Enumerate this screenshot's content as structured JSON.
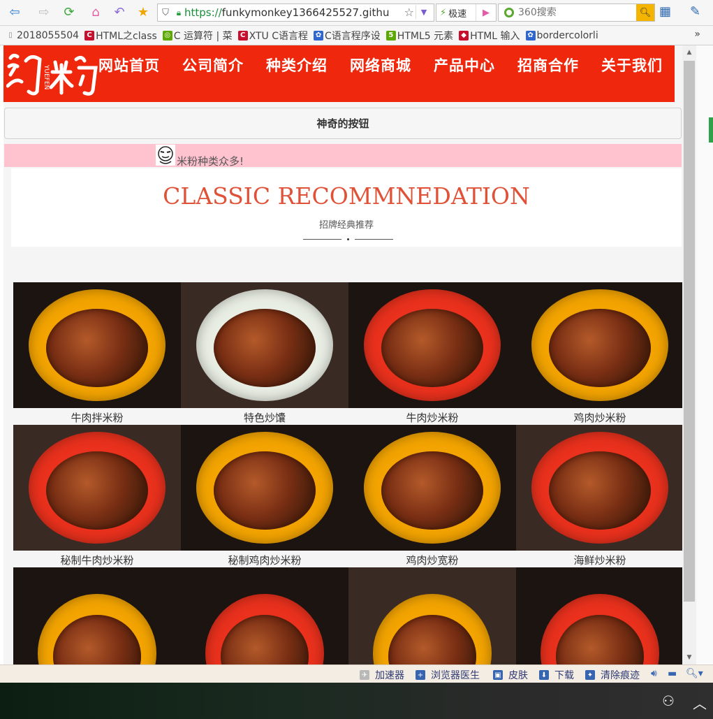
{
  "browser": {
    "url_protocol": "https://",
    "url_rest": "funkymonkey1366425527.githu",
    "speed_label": "极速",
    "search_placeholder": "360搜索",
    "bookmarks": [
      {
        "label": "2018055504",
        "icon": "page-icon",
        "color": "#888888"
      },
      {
        "label": "HTML之class",
        "icon": "c-icon",
        "color": "#c8102e"
      },
      {
        "label": "C 运算符 | 菜",
        "icon": "runoob-icon",
        "color": "#5aa800"
      },
      {
        "label": "XTU C语言程",
        "icon": "c-icon",
        "color": "#c8102e"
      },
      {
        "label": "C语言程序设",
        "icon": "paw-icon",
        "color": "#2f66d0"
      },
      {
        "label": "HTML5 元素",
        "icon": "html5-icon",
        "color": "#5aa800"
      },
      {
        "label": "HTML 输入",
        "icon": "w3-icon",
        "color": "#c8102e"
      },
      {
        "label": "bordercolorli",
        "icon": "paw-icon",
        "color": "#2f66d0"
      }
    ],
    "bookmarks_more": "»"
  },
  "site": {
    "logo_text": "约粉",
    "logo_sub": "YUEFEN",
    "nav": [
      "网站首页",
      "公司简介",
      "种类介绍",
      "网络商城",
      "产品中心",
      "招商合作",
      "关于我们"
    ],
    "magic_button": "神奇的按钮",
    "marquee_text": "米粉种类众多!",
    "classic_title": "CLASSIC RECOMMNEDATION",
    "classic_subtitle": "招牌经典推荐",
    "accent_color": "#ef270c"
  },
  "products": [
    {
      "name": "牛肉拌米粉",
      "bowl": "#f3a400"
    },
    {
      "name": "特色炒馕",
      "bowl": "#e9eee4"
    },
    {
      "name": "牛肉炒米粉",
      "bowl": "#e9311d"
    },
    {
      "name": "鸡肉炒米粉",
      "bowl": "#f3a400"
    },
    {
      "name": "秘制牛肉炒米粉",
      "bowl": "#e9311d"
    },
    {
      "name": "秘制鸡肉炒米粉",
      "bowl": "#f3a400"
    },
    {
      "name": "鸡肉炒宽粉",
      "bowl": "#f3a400"
    },
    {
      "name": "海鲜炒米粉",
      "bowl": "#e9311d"
    },
    {
      "name": "",
      "bowl": "#f3a400"
    },
    {
      "name": "",
      "bowl": "#e9311d"
    },
    {
      "name": "",
      "bowl": "#f3a400"
    },
    {
      "name": "",
      "bowl": "#e9311d"
    }
  ],
  "statusbar": {
    "items": [
      "加速器",
      "浏览器医生",
      "皮肤",
      "下载",
      "清除痕迹"
    ]
  }
}
